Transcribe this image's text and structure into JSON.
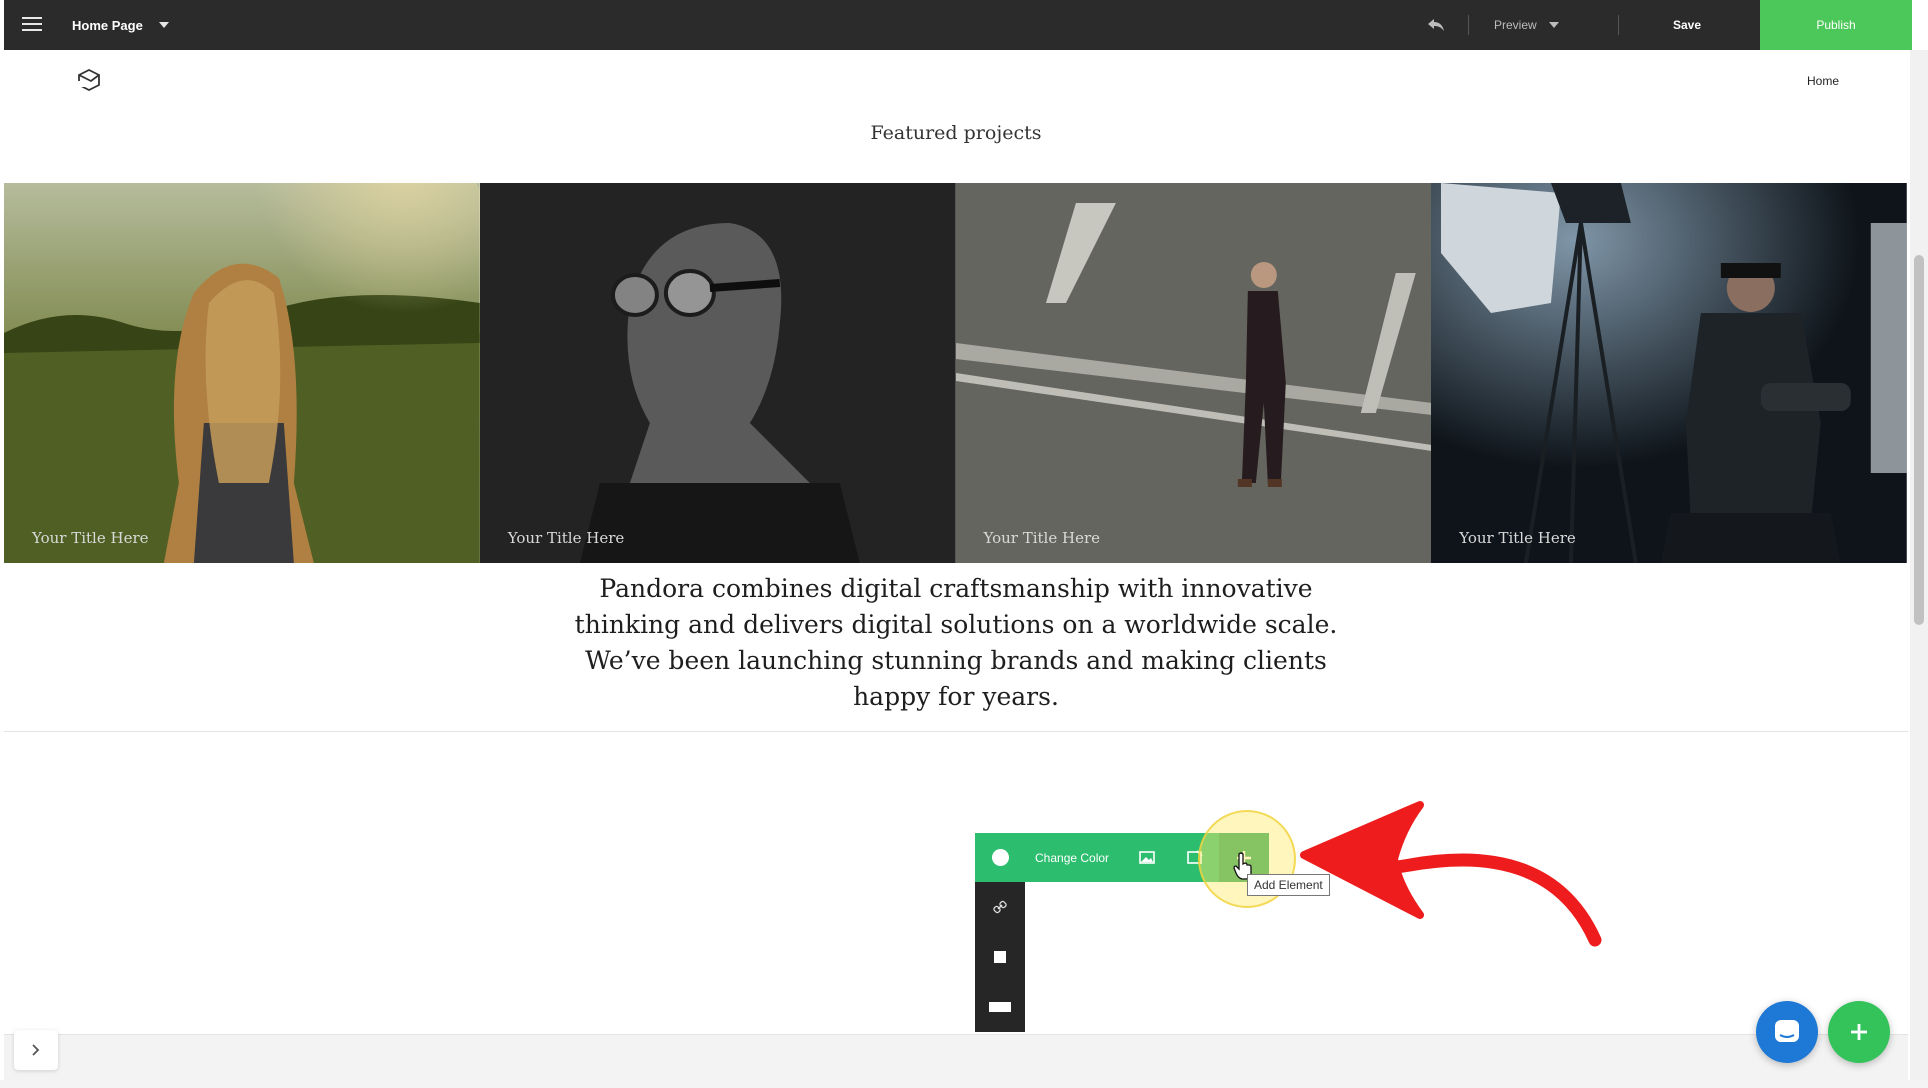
{
  "topbar": {
    "page_name": "Home Page",
    "preview_label": "Preview",
    "save_label": "Save",
    "publish_label": "Publish",
    "publish_color": "#4cc759"
  },
  "site": {
    "nav_home": "Home",
    "section_title": "Featured projects",
    "projects": [
      {
        "title": "Your Title Here",
        "image": "woman-in-sunlit-field"
      },
      {
        "title": "Your Title Here",
        "image": "man-with-goggles"
      },
      {
        "title": "Your Title Here",
        "image": "man-walking-on-road"
      },
      {
        "title": "Your Title Here",
        "image": "photographer-in-studio"
      }
    ],
    "blurb": "Pandora combines digital craftsmanship with innovative thinking and delivers digital solutions on a worldwide scale. We’ve been launching stunning brands and making clients happy for years."
  },
  "editor_toolbar": {
    "change_color_label": "Change Color",
    "add_element_tooltip": "Add Element",
    "accent_color": "#2dbd6e",
    "icons": [
      "circle-swatch-icon",
      "image-icon",
      "edit-image-icon",
      "plus-icon",
      "link-icon",
      "square-icon",
      "wide-rect-icon"
    ]
  },
  "annotation": {
    "arrow_color": "#ee1c1c",
    "highlight_color": "#ffec6e"
  },
  "floating": {
    "chat_color": "#1d78d6",
    "add_color": "#33c35a"
  }
}
